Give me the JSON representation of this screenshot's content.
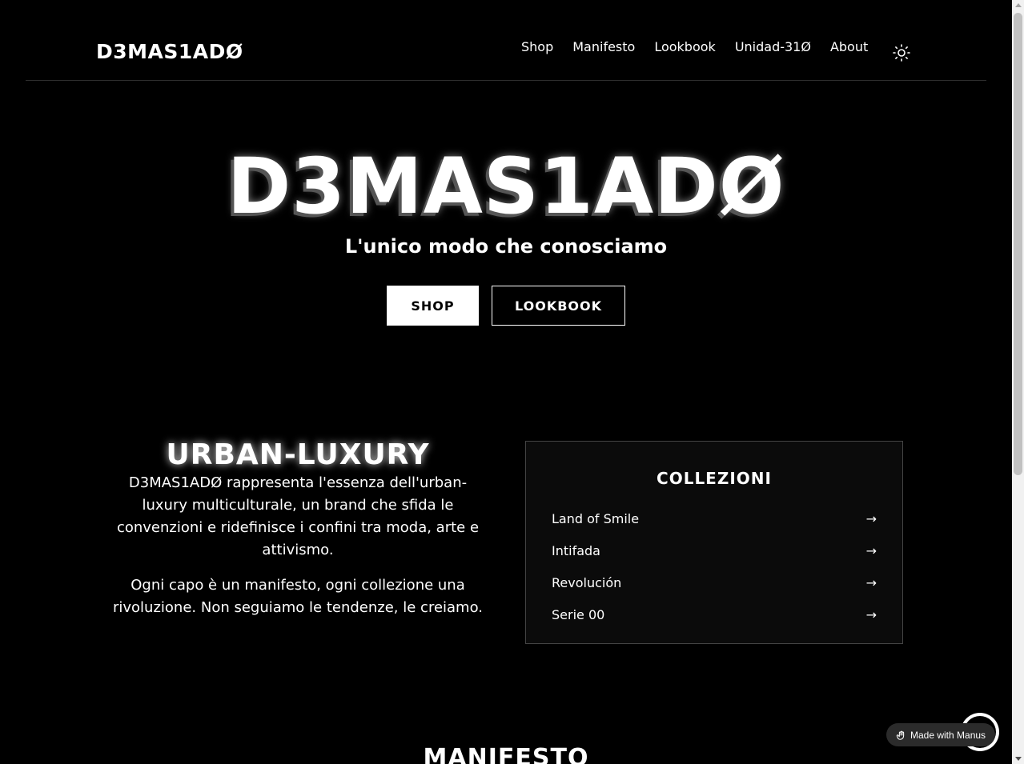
{
  "header": {
    "logo": "D3MAS1ADØ",
    "nav": [
      "Shop",
      "Manifesto",
      "Lookbook",
      "Unidad-31Ø",
      "About"
    ],
    "theme_icon": "sun-icon"
  },
  "hero": {
    "title": "D3MAS1ADØ",
    "subtitle": "L'unico modo che conosciamo",
    "shop_button": "SHOP",
    "lookbook_button": "LOOKBOOK"
  },
  "urban_luxury": {
    "title": "URBAN-LUXURY",
    "paragraph1": "D3MAS1ADØ rappresenta l'essenza dell'urban-luxury multiculturale, un brand che sfida le convenzioni e ridefinisce i confini tra moda, arte e attivismo.",
    "paragraph2": "Ogni capo è un manifesto, ogni collezione una rivoluzione. Non seguiamo le tendenze, le creiamo."
  },
  "collections": {
    "title": "COLLEZIONI",
    "items": [
      {
        "label": "Land of Smile",
        "arrow": "→"
      },
      {
        "label": "Intifada",
        "arrow": "→"
      },
      {
        "label": "Revolución",
        "arrow": "→"
      },
      {
        "label": "Serie 00",
        "arrow": "→"
      }
    ]
  },
  "manifesto": {
    "title": "MANIFESTO"
  },
  "badge": {
    "label": "Made with Manus",
    "icon": "manus-hand-icon"
  },
  "colors": {
    "background": "#000000",
    "text": "#ffffff",
    "panel_border": "#444444"
  }
}
